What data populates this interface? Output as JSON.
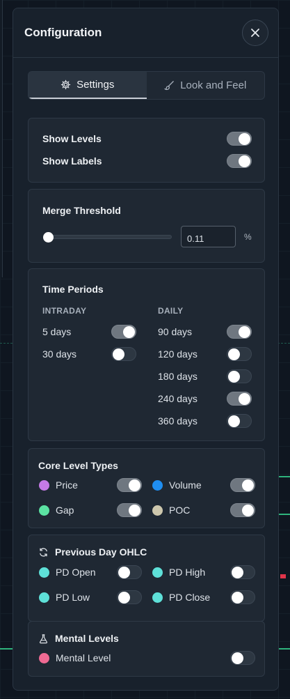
{
  "header": {
    "title": "Configuration"
  },
  "tabs": [
    {
      "label": "Settings",
      "active": true,
      "icon": "gear-icon"
    },
    {
      "label": "Look and Feel",
      "active": false,
      "icon": "brush-icon"
    }
  ],
  "display": {
    "show_levels": {
      "label": "Show Levels",
      "on": true
    },
    "show_labels": {
      "label": "Show Labels",
      "on": true
    }
  },
  "merge": {
    "title": "Merge Threshold",
    "value": "0.11",
    "unit": "%",
    "slider_fraction": 0.0
  },
  "periods": {
    "title": "Time Periods",
    "intraday": {
      "heading": "INTRADAY",
      "items": [
        {
          "label": "5 days",
          "on": true
        },
        {
          "label": "30 days",
          "on": false
        }
      ]
    },
    "daily": {
      "heading": "DAILY",
      "items": [
        {
          "label": "90 days",
          "on": true
        },
        {
          "label": "120 days",
          "on": false
        },
        {
          "label": "180 days",
          "on": false
        },
        {
          "label": "240 days",
          "on": true
        },
        {
          "label": "360 days",
          "on": false
        }
      ]
    }
  },
  "core": {
    "title": "Core Level Types",
    "items": [
      {
        "label": "Price",
        "color": "#c57ae6",
        "on": true
      },
      {
        "label": "Volume",
        "color": "#1f8ef1",
        "on": true
      },
      {
        "label": "Gap",
        "color": "#5be2a2",
        "on": true
      },
      {
        "label": "POC",
        "color": "#cdc7ad",
        "on": true
      }
    ]
  },
  "pd": {
    "title": "Previous Day OHLC",
    "icon": "refresh-icon",
    "items": [
      {
        "label": "PD Open",
        "color": "#5ee0d8",
        "on": false
      },
      {
        "label": "PD High",
        "color": "#5ee0d8",
        "on": false
      },
      {
        "label": "PD Low",
        "color": "#5ee0d8",
        "on": false
      },
      {
        "label": "PD Close",
        "color": "#5ee0d8",
        "on": false
      }
    ]
  },
  "mental": {
    "title": "Mental Levels",
    "icon": "flask-icon",
    "items": [
      {
        "label": "Mental Level",
        "color": "#ef6a93",
        "on": false
      }
    ]
  }
}
